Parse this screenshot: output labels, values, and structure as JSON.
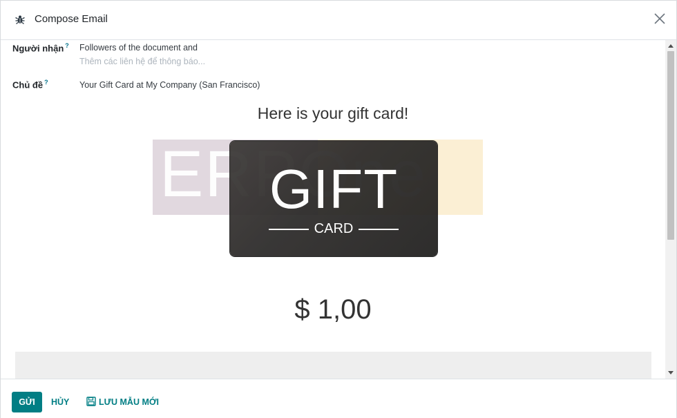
{
  "dialog": {
    "title": "Compose Email"
  },
  "fields": {
    "recipients": {
      "label": "Người nhận",
      "help": "?",
      "value": "Followers of the document and",
      "placeholder": "Thêm các liên hệ để thông báo..."
    },
    "subject": {
      "label": "Chủ đề",
      "help": "?",
      "value": "Your Gift Card at My Company (San Francisco)"
    }
  },
  "email_body": {
    "heading": "Here is your gift card!",
    "watermark_text": "ERPOne",
    "card_title": "GIFT",
    "card_subtitle": "CARD",
    "amount": "$ 1,00"
  },
  "footer": {
    "send_label": "GỬI",
    "cancel_label": "HỦY",
    "save_template_label": "LƯU MẪU MỚI"
  },
  "colors": {
    "primary": "#017e84",
    "help_mark": "#00708a"
  },
  "icons": {
    "header": "bug-icon",
    "close": "close-icon",
    "save": "floppy-disk-icon"
  }
}
